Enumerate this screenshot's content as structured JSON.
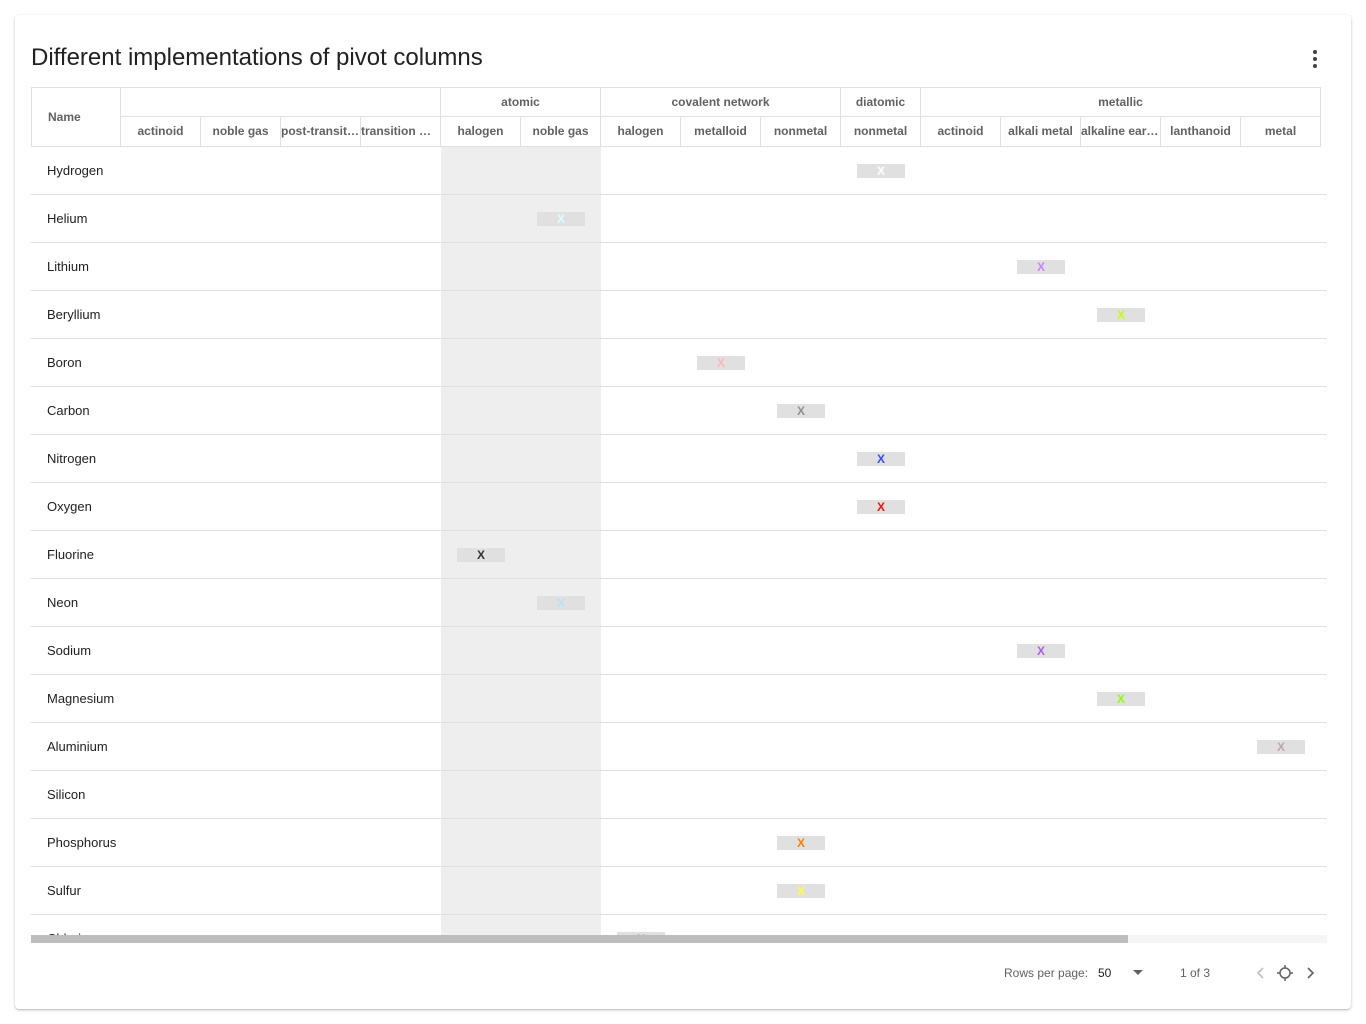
{
  "title": "Different implementations of pivot columns",
  "grid": {
    "name_header": "Name",
    "groups": [
      {
        "label": ""
      },
      {
        "label": "atomic"
      },
      {
        "label": "covalent network"
      },
      {
        "label": "diatomic"
      },
      {
        "label": "metallic"
      }
    ],
    "columns": [
      "actinoid",
      "noble gas",
      "post-transition metal",
      "transition metal",
      "halogen",
      "noble gas",
      "halogen",
      "metalloid",
      "nonmetal",
      "nonmetal",
      "actinoid",
      "alkali metal",
      "alkaline earth metal",
      "lanthanoid",
      "metal"
    ],
    "rows": [
      {
        "name": "Hydrogen",
        "mark": "X",
        "col": 9,
        "color": "#ffffff"
      },
      {
        "name": "Helium",
        "mark": "X",
        "col": 5,
        "color": "#d9ffff"
      },
      {
        "name": "Lithium",
        "mark": "X",
        "col": 11,
        "color": "#cc80ff"
      },
      {
        "name": "Beryllium",
        "mark": "X",
        "col": 12,
        "color": "#c2ff00"
      },
      {
        "name": "Boron",
        "mark": "X",
        "col": 7,
        "color": "#ffb5b5"
      },
      {
        "name": "Carbon",
        "mark": "X",
        "col": 8,
        "color": "#909090"
      },
      {
        "name": "Nitrogen",
        "mark": "X",
        "col": 9,
        "color": "#3050f8"
      },
      {
        "name": "Oxygen",
        "mark": "X",
        "col": 9,
        "color": "#ff0d0d"
      },
      {
        "name": "Fluorine",
        "mark": "X",
        "col": 4,
        "color": "#333333"
      },
      {
        "name": "Neon",
        "mark": "X",
        "col": 5,
        "color": "#b3e3f5"
      },
      {
        "name": "Sodium",
        "mark": "X",
        "col": 11,
        "color": "#ab5cf2"
      },
      {
        "name": "Magnesium",
        "mark": "X",
        "col": 12,
        "color": "#8aff00"
      },
      {
        "name": "Aluminium",
        "mark": "X",
        "col": 14,
        "color": "#bfa6a6"
      },
      {
        "name": "Silicon",
        "mark": "",
        "col": -1,
        "color": "#f0c8a0"
      },
      {
        "name": "Phosphorus",
        "mark": "X",
        "col": 8,
        "color": "#ff8000"
      },
      {
        "name": "Sulfur",
        "mark": "X",
        "col": 8,
        "color": "#ffff30"
      },
      {
        "name": "Chlorine",
        "mark": "X",
        "col": 6,
        "color": "#1ff01f"
      }
    ]
  },
  "footer": {
    "rows_per_page_label": "Rows per page:",
    "rows_per_page_value": "50",
    "page_info": "1 of 3"
  }
}
